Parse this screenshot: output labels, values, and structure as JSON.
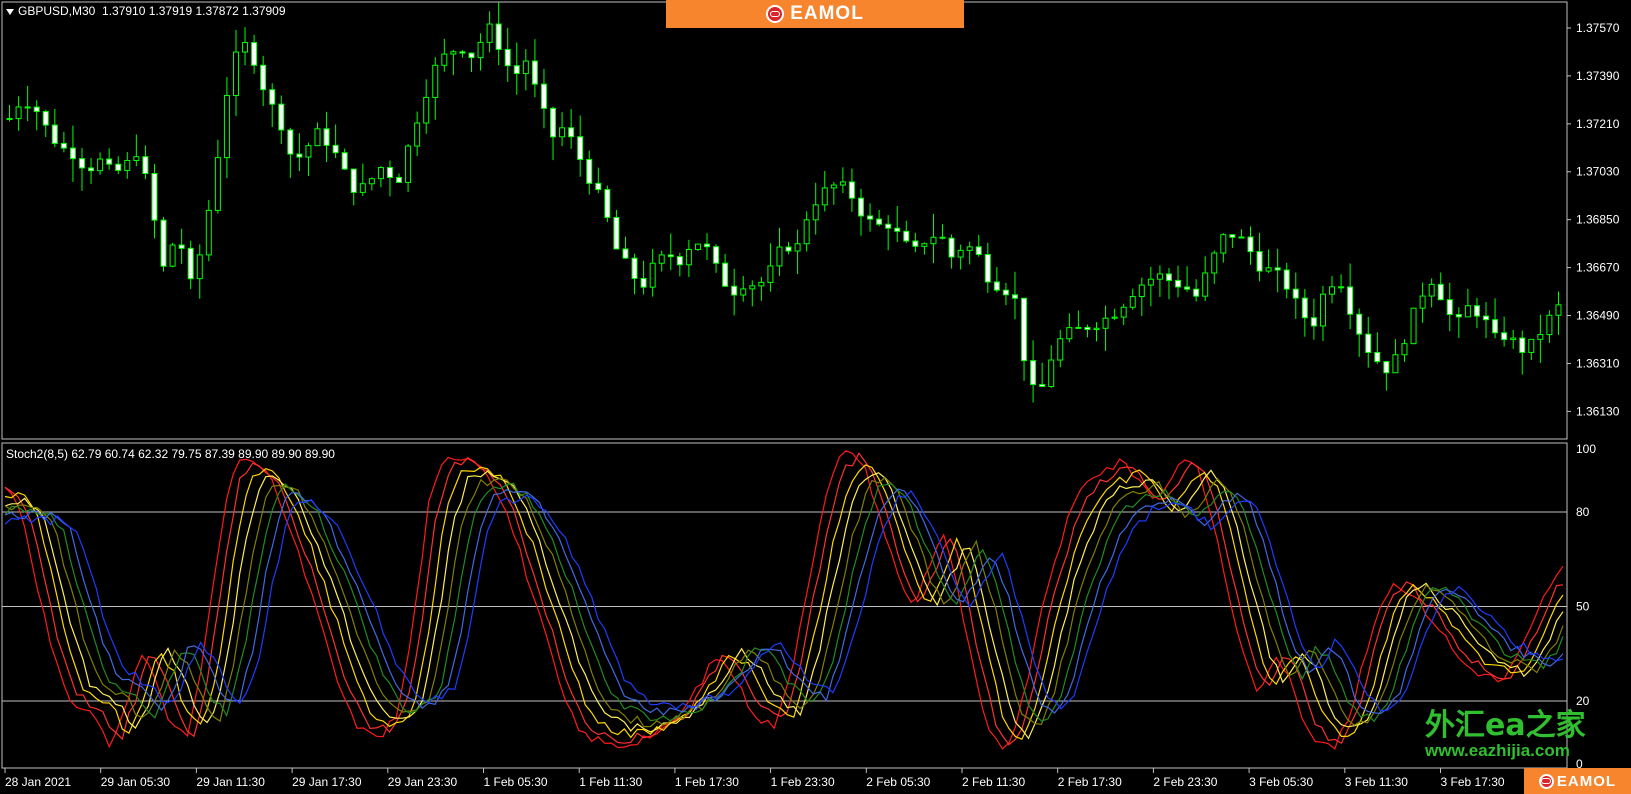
{
  "header": {
    "symbol_label": "GBPUSD,M30  1.37910 1.37919 1.37872 1.37909",
    "banner_brand": "EAMOL"
  },
  "indicator": {
    "label": "Stoch2(8,5) 62.79 60.74 62.32 79.75 87.39 89.90 89.90 89.90"
  },
  "watermark": {
    "cn_text": "外汇ea之家",
    "url": "www.eazhijia.com",
    "corner_brand": "EAMOL"
  },
  "colors": {
    "background": "#000000",
    "bull_candle": "#00ff00",
    "bear_candle": "#ffffff",
    "grid_level": "#c0c0c0",
    "banner": "#f7852e"
  },
  "chart_data": [
    {
      "type": "candlestick",
      "symbol": "GBPUSD",
      "timeframe": "M30",
      "price_axis_ticks": [
        "1.37570",
        "1.37390",
        "1.37210",
        "1.37030",
        "1.36850",
        "1.36670",
        "1.36490",
        "1.36310",
        "1.36130"
      ],
      "ylim": [
        1.3606,
        1.3763
      ],
      "x_ticks": [
        "28 Jan 2021",
        "29 Jan 05:30",
        "29 Jan 11:30",
        "29 Jan 17:30",
        "29 Jan 23:30",
        "1 Feb 05:30",
        "1 Feb 11:30",
        "1 Feb 17:30",
        "1 Feb 23:30",
        "2 Feb 05:30",
        "2 Feb 11:30",
        "2 Feb 17:30",
        "2 Feb 23:30",
        "3 Feb 05:30",
        "3 Feb 11:30",
        "3 Feb 17:30"
      ],
      "close_path": [
        1.3723,
        1.3731,
        1.3727,
        1.3718,
        1.3712,
        1.371,
        1.3704,
        1.3707,
        1.3702,
        1.3705,
        1.3712,
        1.369,
        1.3665,
        1.3682,
        1.366,
        1.3676,
        1.3705,
        1.3738,
        1.3752,
        1.3745,
        1.373,
        1.3722,
        1.3706,
        1.3712,
        1.3718,
        1.3712,
        1.3702,
        1.3695,
        1.37,
        1.3706,
        1.3698,
        1.3714,
        1.373,
        1.3742,
        1.3748,
        1.375,
        1.3746,
        1.3758,
        1.375,
        1.3738,
        1.3745,
        1.373,
        1.3716,
        1.372,
        1.371,
        1.37,
        1.369,
        1.3674,
        1.3666,
        1.366,
        1.3668,
        1.3672,
        1.367,
        1.3678,
        1.3674,
        1.3664,
        1.3658,
        1.3662,
        1.366,
        1.3666,
        1.3676,
        1.3674,
        1.369,
        1.3695,
        1.3698,
        1.3696,
        1.3688,
        1.3682,
        1.3684,
        1.3678,
        1.3672,
        1.3678,
        1.368,
        1.3671,
        1.3676,
        1.3672,
        1.3662,
        1.366,
        1.3654,
        1.362,
        1.3622,
        1.3638,
        1.3642,
        1.3644,
        1.3646,
        1.3648,
        1.3652,
        1.3658,
        1.3662,
        1.3664,
        1.3662,
        1.366,
        1.3656,
        1.3668,
        1.3678,
        1.368,
        1.3674,
        1.3667,
        1.3665,
        1.366,
        1.365,
        1.3646,
        1.366,
        1.3664,
        1.365,
        1.3638,
        1.3632,
        1.3628,
        1.364,
        1.3652,
        1.3664,
        1.3656,
        1.3644,
        1.3652,
        1.365,
        1.364,
        1.3642,
        1.3636,
        1.3638,
        1.3646,
        1.3652
      ]
    },
    {
      "type": "line",
      "title": "Stoch2(8,5)",
      "values_printed": [
        62.79,
        60.74,
        62.32,
        79.75,
        87.39,
        89.9,
        89.9,
        89.9
      ],
      "levels": [
        20,
        50,
        80
      ],
      "axis_ticks": [
        "100",
        "80",
        "50",
        "20",
        "0"
      ],
      "ylim": [
        0,
        100
      ],
      "series_colors": [
        "#ff1a1a",
        "#ff3030",
        "#ffd700",
        "#ffee55",
        "#808000",
        "#228b22",
        "#4169e1",
        "#1e3cff"
      ],
      "main_path": [
        88,
        82,
        60,
        38,
        22,
        18,
        15,
        5,
        18,
        35,
        28,
        12,
        8,
        30,
        65,
        92,
        98,
        94,
        86,
        72,
        58,
        42,
        26,
        14,
        9,
        10,
        16,
        45,
        82,
        96,
        98,
        97,
        92,
        82,
        68,
        52,
        36,
        20,
        10,
        8,
        6,
        6,
        8,
        10,
        12,
        18,
        26,
        34,
        30,
        20,
        14,
        12,
        30,
        55,
        80,
        96,
        100,
        92,
        76,
        60,
        50,
        62,
        74,
        55,
        30,
        10,
        4,
        14,
        36,
        58,
        74,
        86,
        92,
        94,
        96,
        90,
        84,
        90,
        98,
        92,
        74,
        52,
        32,
        22,
        34,
        28,
        12,
        6,
        6,
        16,
        36,
        52,
        58,
        54,
        48,
        42,
        34,
        30,
        28,
        26,
        34,
        44,
        56,
        62
      ]
    }
  ]
}
